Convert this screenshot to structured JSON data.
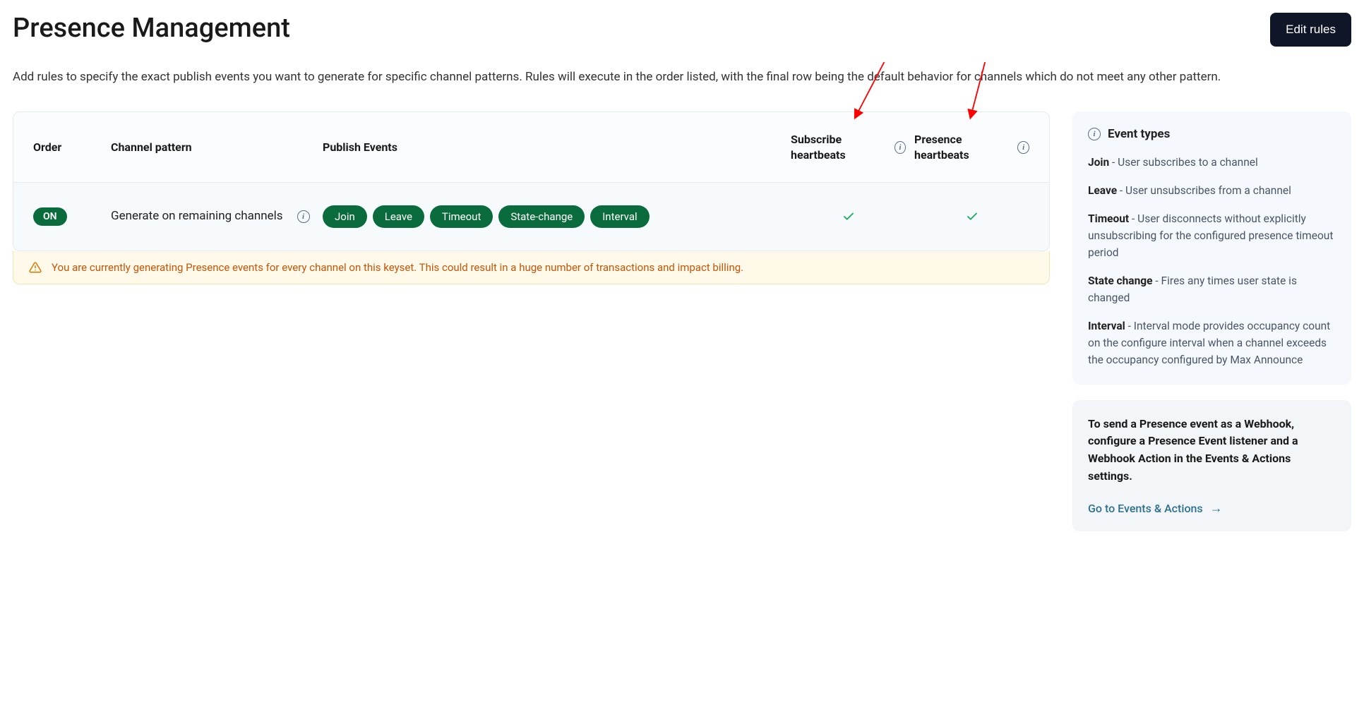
{
  "page_title": "Presence Management",
  "edit_button": "Edit rules",
  "description": "Add rules to specify the exact publish events you want to generate for specific channel patterns. Rules will execute in the order listed, with the final row being the default behavior for channels which do not meet any other pattern.",
  "table": {
    "headers": {
      "order": "Order",
      "channel_pattern": "Channel pattern",
      "publish_events": "Publish Events",
      "subscribe_heartbeats": "Subscribe heartbeats",
      "presence_heartbeats": "Presence heartbeats"
    },
    "row": {
      "order_badge": "ON",
      "channel_pattern": "Generate on remaining channels",
      "events": [
        "Join",
        "Leave",
        "Timeout",
        "State-change",
        "Interval"
      ],
      "subscribe_checked": true,
      "presence_checked": true
    }
  },
  "warning": "You are currently generating Presence events for every channel on this keyset. This could result in a huge number of transactions and impact billing.",
  "sidebar": {
    "event_types_title": "Event types",
    "defs": {
      "join_label": "Join",
      "join_desc": " - User subscribes to a channel",
      "leave_label": "Leave",
      "leave_desc": " - User unsubscribes from a channel",
      "timeout_label": "Timeout",
      "timeout_desc": " - User disconnects without explicitly unsubscribing for the configured presence timeout period",
      "state_label": "State change",
      "state_desc": " - Fires any times user state is changed",
      "interval_label": "Interval",
      "interval_desc": " - Interval mode provides occupancy count on the configure interval when a channel exceeds the occupancy configured by Max Announce"
    },
    "webhook_note": "To send a Presence event as a Webhook, configure a Presence Event listener and a Webhook Action in the Events & Actions settings.",
    "goto_link": "Go to Events & Actions"
  }
}
